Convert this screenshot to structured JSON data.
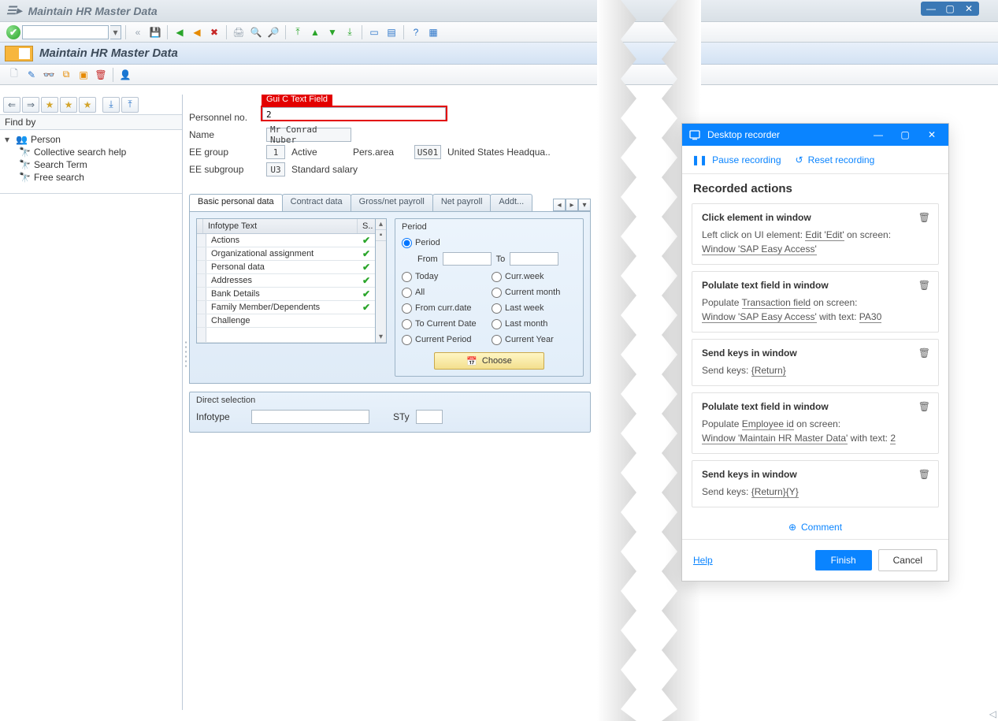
{
  "window_title": "Maintain HR Master Data",
  "page_title": "Maintain HR Master Data",
  "annotation_label": "Gui C Text Field",
  "find_by_label": "Find by",
  "tree": {
    "root": "Person",
    "children": [
      "Collective search help",
      "Search Term",
      "Free search"
    ]
  },
  "form": {
    "personnel_no_label": "Personnel no.",
    "personnel_no_value": "2",
    "name_label": "Name",
    "name_value": "Mr Conrad Nuber",
    "ee_group_label": "EE group",
    "ee_group_code": "1",
    "ee_group_text": "Active",
    "pers_area_label": "Pers.area",
    "pers_area_code": "US01",
    "pers_area_text": "United States Headqua..",
    "ee_subgroup_label": "EE subgroup",
    "ee_subgroup_code": "U3",
    "ee_subgroup_text": "Standard salary"
  },
  "tabs": [
    "Basic personal data",
    "Contract data",
    "Gross/net payroll",
    "Net payroll",
    "Addt..."
  ],
  "active_tab": 0,
  "grid": {
    "header_text": "Infotype Text",
    "header_status": "S..",
    "rows": [
      {
        "text": "Actions",
        "ok": true
      },
      {
        "text": "Organizational assignment",
        "ok": true
      },
      {
        "text": "Personal data",
        "ok": true
      },
      {
        "text": "Addresses",
        "ok": true
      },
      {
        "text": "Bank Details",
        "ok": true
      },
      {
        "text": "Family Member/Dependents",
        "ok": true
      },
      {
        "text": "Challenge",
        "ok": false
      }
    ]
  },
  "period": {
    "legend": "Period",
    "period_opt": "Period",
    "from_label": "From",
    "to_label": "To",
    "today": "Today",
    "curr_week": "Curr.week",
    "all": "All",
    "current_month": "Current month",
    "from_curr_date": "From curr.date",
    "last_week": "Last week",
    "to_current_date": "To Current Date",
    "last_month": "Last month",
    "current_period": "Current Period",
    "current_year": "Current Year",
    "choose": "Choose"
  },
  "direct": {
    "legend": "Direct selection",
    "infotype_label": "Infotype",
    "sty_label": "STy"
  },
  "recorder": {
    "title": "Desktop recorder",
    "pause": "Pause recording",
    "reset": "Reset recording",
    "heading": "Recorded actions",
    "comment": "Comment",
    "help": "Help",
    "finish": "Finish",
    "cancel": "Cancel",
    "cards": [
      {
        "title": "Click element in window",
        "line1_pre": "Left click on UI element: ",
        "line1_link": "Edit 'Edit'",
        "line1_post": " on screen:",
        "line2": "Window 'SAP Easy Access'"
      },
      {
        "title": "Polulate text field in window",
        "line1_pre": "Populate ",
        "line1_link": "Transaction field",
        "line1_post": " on screen:",
        "line2": "Window 'SAP Easy Access'",
        "line2_post": " with text: ",
        "line2_val": "PA30"
      },
      {
        "title": "Send keys in window",
        "line1_pre": "Send keys: ",
        "line1_link": "{Return}",
        "line1_post": ""
      },
      {
        "title": "Polulate text field in window",
        "line1_pre": "Populate ",
        "line1_link": "Employee id",
        "line1_post": " on screen:",
        "line2": "Window 'Maintain HR Master Data'",
        "line2_post": " with text: ",
        "line2_val": "2"
      },
      {
        "title": "Send keys in window",
        "line1_pre": "Send keys: ",
        "line1_link": "{Return}{Y}",
        "line1_post": ""
      }
    ]
  }
}
